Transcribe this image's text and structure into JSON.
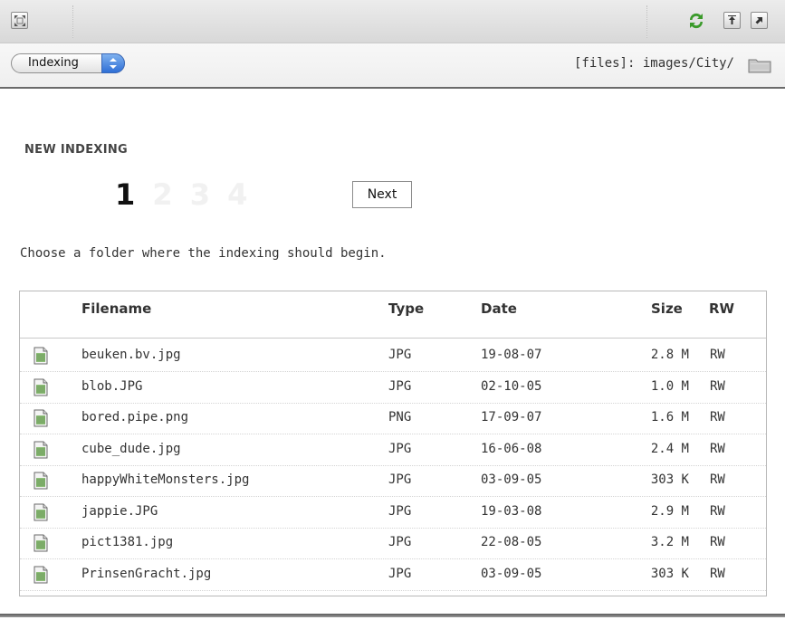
{
  "toolbar": {
    "icons": [
      "expand-icon",
      "refresh-icon",
      "upload-icon",
      "external-link-icon"
    ]
  },
  "modebar": {
    "mode_value": "Indexing",
    "path": "[files]: images/City/"
  },
  "main": {
    "section_title": "NEW INDEXING",
    "steps": [
      "1",
      "2",
      "3",
      "4"
    ],
    "active_step": "1",
    "next_label": "Next",
    "instruction": "Choose a folder where the indexing should begin."
  },
  "table": {
    "headers": {
      "filename": "Filename",
      "type": "Type",
      "date": "Date",
      "size": "Size",
      "rw": "RW"
    },
    "rows": [
      {
        "name": "beuken.bv.jpg",
        "type": "JPG",
        "date": "19-08-07",
        "size": "2.8 M",
        "rw": "RW"
      },
      {
        "name": "blob.JPG",
        "type": "JPG",
        "date": "02-10-05",
        "size": "1.0 M",
        "rw": "RW"
      },
      {
        "name": "bored.pipe.png",
        "type": "PNG",
        "date": "17-09-07",
        "size": "1.6 M",
        "rw": "RW"
      },
      {
        "name": "cube_dude.jpg",
        "type": "JPG",
        "date": "16-06-08",
        "size": "2.4 M",
        "rw": "RW"
      },
      {
        "name": "happyWhiteMonsters.jpg",
        "type": "JPG",
        "date": "03-09-05",
        "size": "303 K",
        "rw": "RW"
      },
      {
        "name": "jappie.JPG",
        "type": "JPG",
        "date": "19-03-08",
        "size": "2.9 M",
        "rw": "RW"
      },
      {
        "name": "pict1381.jpg",
        "type": "JPG",
        "date": "22-08-05",
        "size": "3.2 M",
        "rw": "RW"
      },
      {
        "name": "PrinsenGracht.jpg",
        "type": "JPG",
        "date": "03-09-05",
        "size": "303 K",
        "rw": "RW"
      }
    ]
  },
  "colors": {
    "accent_blue": "#2f6fd6",
    "refresh_green": "#3a9a2a",
    "file_icon_green": "#8fbf7a"
  }
}
